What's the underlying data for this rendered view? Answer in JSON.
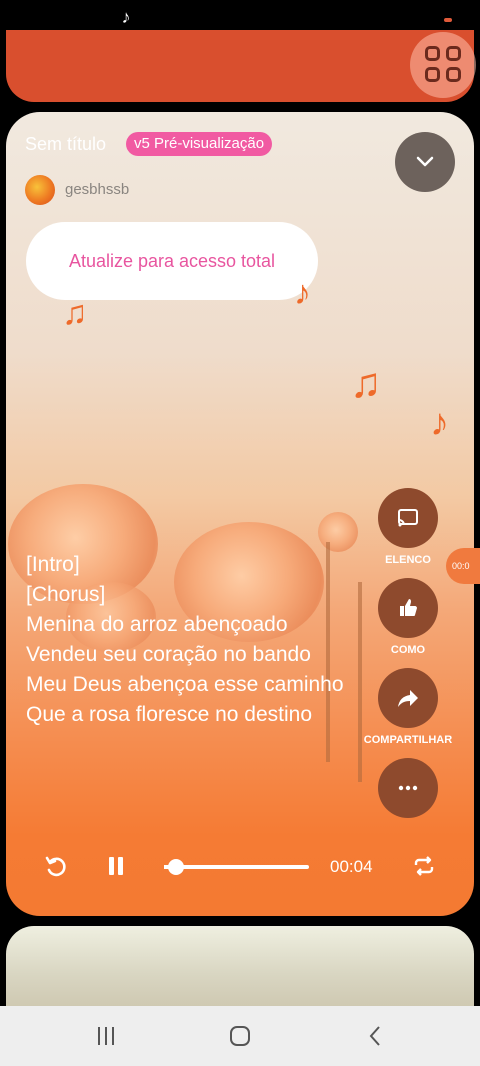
{
  "player": {
    "title": "Sem título",
    "badge": "v5 Pré-visualização",
    "username": "gesbhssb",
    "upgrade_text": "Atualize para acesso total",
    "lyrics": [
      "[Intro]",
      "[Chorus]",
      "Menina do arroz abençoado",
      "Vendeu seu coração no bando",
      "Meu Deus abençoa esse caminho",
      "Que a rosa floresce no destino"
    ],
    "side_actions": [
      {
        "label": "ELENCO",
        "icon": "cast-icon"
      },
      {
        "label": "COMO",
        "icon": "thumbs-up-icon"
      },
      {
        "label": "COMPARTILHAR",
        "icon": "share-icon"
      },
      {
        "label": "",
        "icon": "more-icon"
      }
    ],
    "progress_tab_text": "00:0",
    "time": "00:04",
    "progress_fraction": 0.08
  },
  "colors": {
    "accent_pink": "#f15aa2",
    "player_orange": "#f47a32",
    "top_card_red": "#d94f2e"
  },
  "icons": {
    "status": "tiktok-icon",
    "grid": "grid-icon",
    "collapse": "chevron-down-icon",
    "replay": "replay-icon",
    "pause": "pause-icon",
    "repeat": "repeat-icon",
    "nav": [
      "recent-apps-icon",
      "home-icon",
      "back-icon"
    ]
  }
}
